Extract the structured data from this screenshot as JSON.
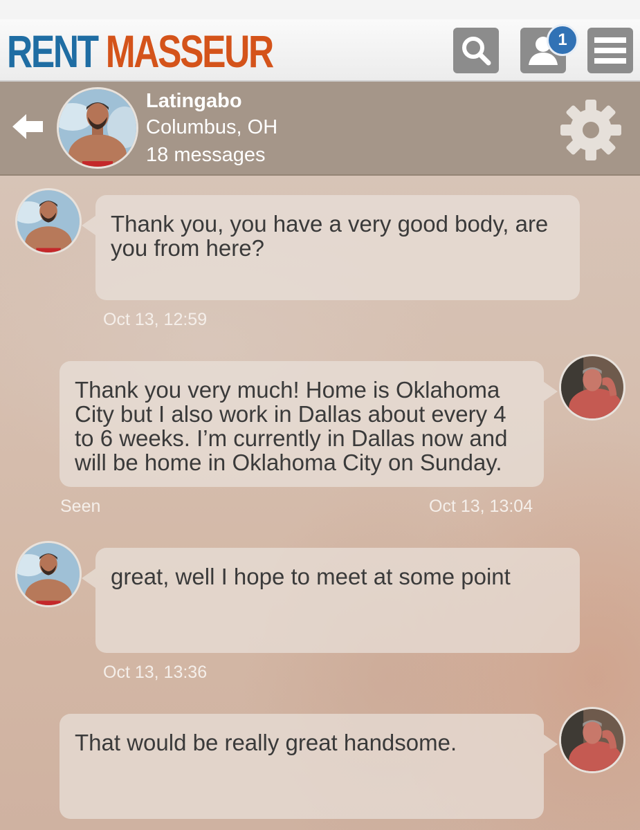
{
  "app": {
    "logo_word1": "RENT",
    "logo_word2": "MASSEUR",
    "notification_count": "1",
    "brand_blue": "#1f6da3",
    "brand_orange": "#d4531a",
    "toolbar_icons": [
      "search-icon",
      "profile-icon",
      "menu-icon"
    ]
  },
  "conversation": {
    "name": "Latingabo",
    "location": "Columbus, OH",
    "message_count": "18 messages",
    "header_icons": [
      "back-arrow-icon",
      "gear-icon"
    ]
  },
  "messages": [
    {
      "direction": "incoming",
      "text": "Thank you, you have a very good body, are you from here?",
      "time": "Oct 13, 12:59"
    },
    {
      "direction": "outgoing",
      "text": "Thank you very much! Home is Oklahoma City but I also work in Dallas about every 4 to 6 weeks. I’m currently in Dallas now and will be home in Oklahoma City on Sunday.",
      "status": "Seen",
      "time": "Oct 13, 13:04"
    },
    {
      "direction": "incoming",
      "text": "great, well I hope to meet at some point",
      "time": "Oct 13, 13:36"
    },
    {
      "direction": "outgoing",
      "text": "That would be really great handsome."
    }
  ]
}
